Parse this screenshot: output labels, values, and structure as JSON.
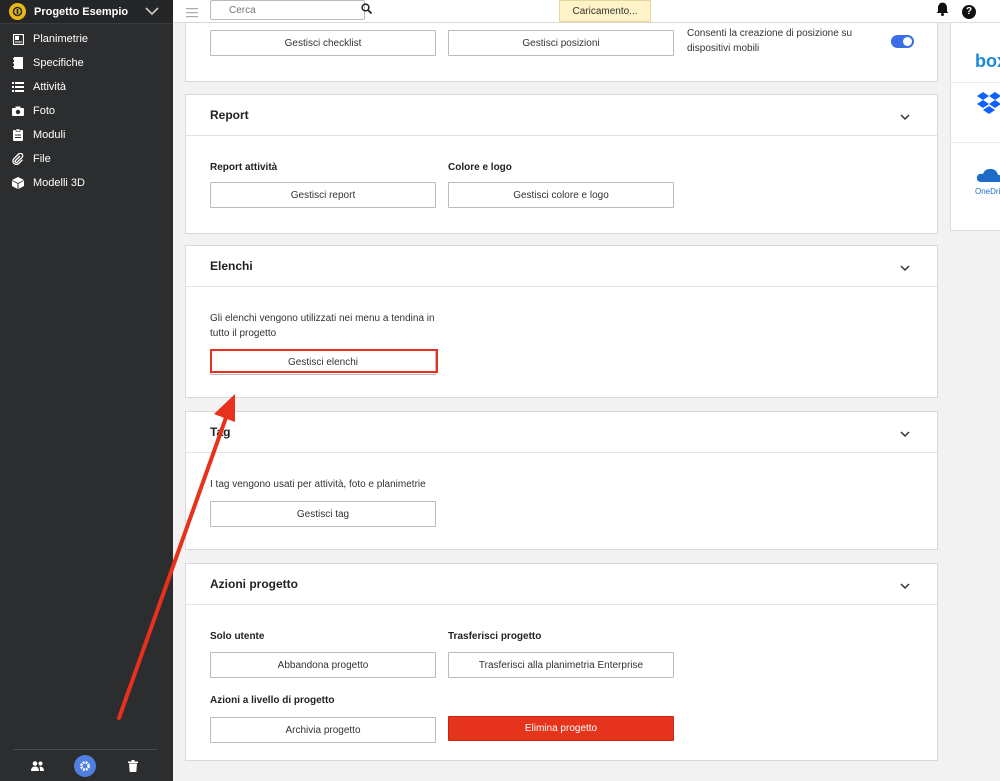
{
  "sidebar": {
    "project_name": "Progetto Esempio",
    "items": [
      {
        "label": "Planimetrie",
        "icon": "floorplan-icon"
      },
      {
        "label": "Specifiche",
        "icon": "specifications-icon"
      },
      {
        "label": "Attività",
        "icon": "task-list-icon"
      },
      {
        "label": "Foto",
        "icon": "camera-icon"
      },
      {
        "label": "Moduli",
        "icon": "clipboard-icon"
      },
      {
        "label": "File",
        "icon": "paperclip-icon"
      },
      {
        "label": "Modelli 3D",
        "icon": "cube-icon"
      }
    ],
    "footer_icons": [
      "people-icon",
      "gear-icon",
      "trash-icon"
    ]
  },
  "topbar": {
    "search_placeholder": "Cerca",
    "loading_text": "Caricamento..."
  },
  "sections": {
    "top": {
      "checklist_button": "Gestisci checklist",
      "positions_button": "Gestisci posizioni",
      "mobile_positions_text": "Consenti la creazione di posizione su dispositivi mobili",
      "mobile_positions_enabled": true
    },
    "report": {
      "title": "Report",
      "report_label": "Report attività",
      "report_button": "Gestisci report",
      "color_label": "Colore e logo",
      "color_button": "Gestisci colore e logo"
    },
    "lists": {
      "title": "Elenchi",
      "description": "Gli elenchi vengono utilizzati nei menu a tendina in tutto il progetto",
      "button": "Gestisci elenchi"
    },
    "tags": {
      "title": "Tag",
      "description": "I tag vengono usati per attività, foto e planimetrie",
      "button": "Gestisci tag"
    },
    "actions": {
      "title": "Azioni progetto",
      "user_label": "Solo utente",
      "leave_button": "Abbandona progetto",
      "transfer_label": "Trasferisci progetto",
      "transfer_button": "Trasferisci alla planimetria Enterprise",
      "project_level_label": "Azioni a livello di progetto",
      "archive_button": "Archivia progetto",
      "delete_button": "Elimina progetto"
    }
  },
  "integrations": {
    "box_label": "box",
    "onedrive_label": "OneDrive"
  },
  "colors": {
    "sidebar_bg": "#2c2d2e",
    "accent_blue": "#3b6ee6",
    "danger_red": "#e5341b",
    "annotation_red": "#e8301c"
  }
}
